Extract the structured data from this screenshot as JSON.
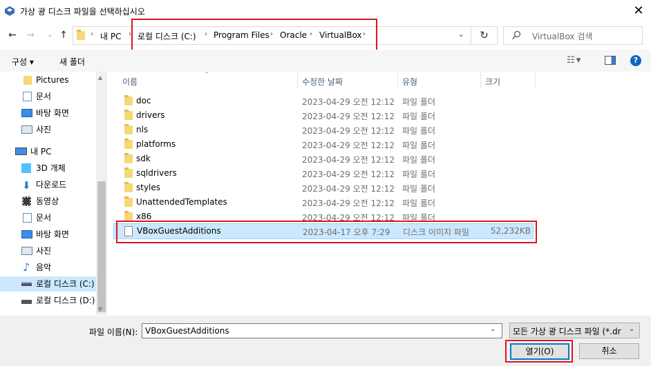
{
  "window": {
    "title": "가상 광 디스크 파일을 선택하십시오"
  },
  "breadcrumb": [
    "내 PC",
    "로컬 디스크 (C:)",
    "Program Files",
    "Oracle",
    "VirtualBox"
  ],
  "search": {
    "placeholder": "VirtualBox 검색"
  },
  "toolbar": {
    "organize_label": "구성 ▾",
    "new_folder_label": "새 폴더"
  },
  "nav": {
    "items": [
      {
        "label": "Pictures",
        "icon": "folder-icon"
      },
      {
        "label": "문서",
        "icon": "document-icon"
      },
      {
        "label": "바탕 화면",
        "icon": "desktop-icon"
      },
      {
        "label": "사진",
        "icon": "picture-icon"
      },
      {
        "label": "내 PC",
        "icon": "computer-icon"
      },
      {
        "label": "3D 개체",
        "icon": "cube-icon"
      },
      {
        "label": "다운로드",
        "icon": "download-icon"
      },
      {
        "label": "동영상",
        "icon": "video-icon"
      },
      {
        "label": "문서",
        "icon": "document-icon"
      },
      {
        "label": "바탕 화면",
        "icon": "desktop-icon"
      },
      {
        "label": "사진",
        "icon": "picture-icon"
      },
      {
        "label": "음악",
        "icon": "music-icon"
      },
      {
        "label": "로컬 디스크 (C:)",
        "icon": "drive-icon"
      },
      {
        "label": "로컬 디스크 (D:)",
        "icon": "drive-icon"
      }
    ]
  },
  "columns": {
    "name": "이름",
    "date": "수정한 날짜",
    "type": "유형",
    "size": "크기"
  },
  "files": [
    {
      "name": "doc",
      "date": "2023-04-29 오전 12:12",
      "type": "파일 폴더",
      "size": ""
    },
    {
      "name": "drivers",
      "date": "2023-04-29 오전 12:12",
      "type": "파일 폴더",
      "size": ""
    },
    {
      "name": "nls",
      "date": "2023-04-29 오전 12:12",
      "type": "파일 폴더",
      "size": ""
    },
    {
      "name": "platforms",
      "date": "2023-04-29 오전 12:12",
      "type": "파일 폴더",
      "size": ""
    },
    {
      "name": "sdk",
      "date": "2023-04-29 오전 12:12",
      "type": "파일 폴더",
      "size": ""
    },
    {
      "name": "sqldrivers",
      "date": "2023-04-29 오전 12:12",
      "type": "파일 폴더",
      "size": ""
    },
    {
      "name": "styles",
      "date": "2023-04-29 오전 12:12",
      "type": "파일 폴더",
      "size": ""
    },
    {
      "name": "UnattendedTemplates",
      "date": "2023-04-29 오전 12:12",
      "type": "파일 폴더",
      "size": ""
    },
    {
      "name": "x86",
      "date": "2023-04-29 오전 12:12",
      "type": "파일 폴더",
      "size": ""
    },
    {
      "name": "VBoxGuestAdditions",
      "date": "2023-04-17 오후 7:29",
      "type": "디스크 이미지 파일",
      "size": "52,232KB"
    }
  ],
  "bottom": {
    "filename_label": "파일 이름(N):",
    "filename_value": "VBoxGuestAdditions",
    "filter_value": "모든 가상 광 디스크 파일 (*.dr",
    "open_label": "열기(O)",
    "cancel_label": "취소"
  },
  "colors": {
    "highlight": "#e0141e",
    "selection": "#cce8ff",
    "accent": "#0078d7"
  }
}
